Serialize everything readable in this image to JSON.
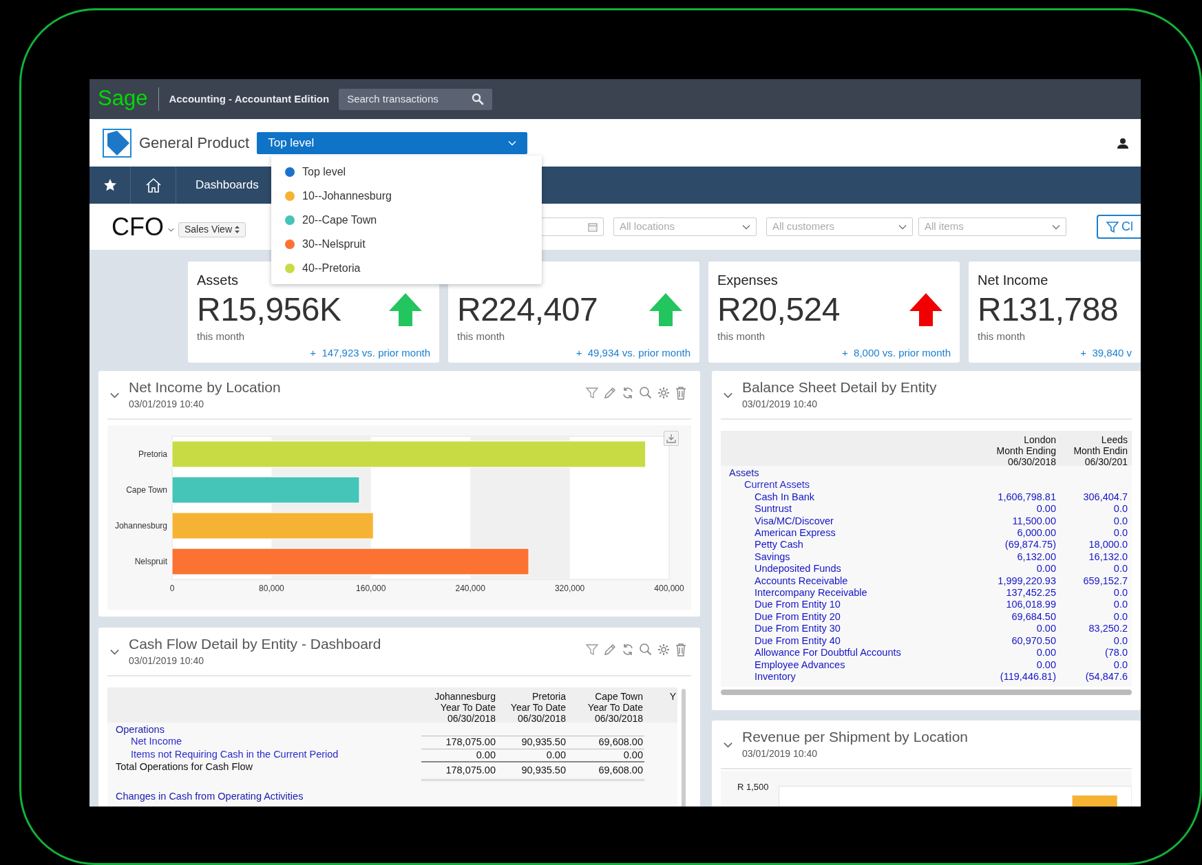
{
  "top_bar": {
    "brand": "Sage",
    "product": "Accounting - Accountant Edition",
    "search": {
      "placeholder": "Search transactions"
    }
  },
  "header": {
    "company": "General Product",
    "entity_select": {
      "value": "Top level",
      "expanded": true
    }
  },
  "entity_menu": [
    {
      "label": "Top level",
      "color": "#1a73c9"
    },
    {
      "label": "10--Johannesburg",
      "color": "#f6b333"
    },
    {
      "label": "20--Cape Town",
      "color": "#45c4b8"
    },
    {
      "label": "30--Nelspruit",
      "color": "#fb7232"
    },
    {
      "label": "40--Pretoria",
      "color": "#c8db45"
    }
  ],
  "nav": {
    "label": "Dashboards"
  },
  "toolbar": {
    "title": "CFO",
    "view_select": "Sales View",
    "filters": [
      {
        "placeholder": "All locations"
      },
      {
        "placeholder": "All customers"
      },
      {
        "placeholder": "All items"
      }
    ],
    "filter_button": "Cl"
  },
  "kpis": [
    {
      "title": "Assets",
      "value": "R15,956K",
      "period": "this month",
      "change": "+  147,923 vs. prior month",
      "color": "#22c55e"
    },
    {
      "value": "R224,407",
      "period": "this month",
      "change": "+  49,934 vs. prior month",
      "color": "#22c55e"
    },
    {
      "title": "Expenses",
      "value": "R20,524",
      "period": "this month",
      "change": "+  8,000 vs. prior month",
      "color": "#f00000"
    },
    {
      "title": "Net Income",
      "value": "R131,788",
      "period": "this month",
      "change": "+  39,840 v"
    }
  ],
  "left_panels": [
    {
      "kind": "bar_chart",
      "title": "Net Income by Location",
      "timestamp": "03/01/2019 10:40",
      "show_tools": true,
      "chart_data": {
        "type": "bar",
        "orientation": "horizontal",
        "categories": [
          "Pretoria",
          "Cape Town",
          "Johannesburg",
          "Nelspruit"
        ],
        "values": [
          381000,
          150700,
          161900,
          287000
        ],
        "colors": [
          "#c8db45",
          "#45c4b8",
          "#f6b333",
          "#fb7232"
        ],
        "xlim": [
          0,
          400000
        ],
        "xticks": [
          0,
          {
            "value": 80000,
            "label": "80,000"
          },
          {
            "value": 160000,
            "label": "160,000"
          },
          {
            "value": 240000,
            "label": "240,000"
          },
          {
            "value": 320000,
            "label": "320,000"
          },
          {
            "value": 400000,
            "label": "400,000"
          }
        ]
      }
    },
    {
      "kind": "table",
      "title": "Cash Flow Detail by Entity - Dashboard",
      "timestamp": "03/01/2019 10:40",
      "show_tools": true,
      "columns": [
        [
          "Johannesburg",
          "Year To Date",
          "06/30/2018"
        ],
        [
          "Pretoria",
          "Year To Date",
          "06/30/2018"
        ],
        [
          "Cape Town",
          "Year To Date",
          "06/30/2018"
        ],
        [
          "Y"
        ]
      ],
      "rows": [
        {
          "kind": "section",
          "label": "Operations",
          "values": []
        },
        {
          "kind": "item",
          "label": "Net Income",
          "values": [
            "178,075.00",
            "90,935.50",
            "69,608.00"
          ]
        },
        {
          "kind": "item",
          "label": "Items not Requiring Cash in the Current Period",
          "values": [
            "0.00",
            "0.00",
            "0.00"
          ]
        },
        {
          "kind": "total",
          "label": "Total Operations for Cash Flow",
          "values": [
            "178,075.00",
            "90,935.50",
            "69,608.00"
          ]
        },
        {
          "kind": "section",
          "label": "Changes in Cash from Operating Activities",
          "values": []
        }
      ]
    }
  ],
  "right_panels": [
    {
      "kind": "table",
      "title": "Balance Sheet Detail by Entity",
      "timestamp": "03/01/2019 10:40",
      "show_tools": false,
      "columns": [
        [
          "London",
          "Month Ending",
          "06/30/2018"
        ],
        [
          "Leeds",
          "Month Endin",
          "06/30/201"
        ]
      ],
      "rows": [
        {
          "kind": "section",
          "label": "Assets",
          "values": []
        },
        {
          "kind": "group",
          "label": "Current Assets",
          "values": []
        },
        {
          "kind": "account",
          "label": "Cash In Bank",
          "values": [
            "1,606,798.81",
            "306,404.7"
          ]
        },
        {
          "kind": "account",
          "label": "Suntrust",
          "values": [
            "0.00",
            "0.0"
          ]
        },
        {
          "kind": "account",
          "label": "Visa/MC/Discover",
          "values": [
            "11,500.00",
            "0.0"
          ]
        },
        {
          "kind": "account",
          "label": "American Express",
          "values": [
            "6,000.00",
            "0.0"
          ]
        },
        {
          "kind": "account",
          "label": "Petty Cash",
          "values": [
            "(69,874.75)",
            "18,000.0"
          ]
        },
        {
          "kind": "account",
          "label": "Savings",
          "values": [
            "6,132.00",
            "16,132.0"
          ]
        },
        {
          "kind": "account",
          "label": "Undeposited Funds",
          "values": [
            "0.00",
            "0.0"
          ]
        },
        {
          "kind": "account",
          "label": "Accounts Receivable",
          "values": [
            "1,999,220.93",
            "659,152.7"
          ]
        },
        {
          "kind": "account",
          "label": "Intercompany Receivable",
          "values": [
            "137,452.25",
            "0.0"
          ]
        },
        {
          "kind": "account",
          "label": "Due From Entity 10",
          "values": [
            "106,018.99",
            "0.0"
          ]
        },
        {
          "kind": "account",
          "label": "Due From Entity 20",
          "values": [
            "69,684.50",
            "0.0"
          ]
        },
        {
          "kind": "account",
          "label": "Due From Entity 30",
          "values": [
            "0.00",
            "83,250.2"
          ]
        },
        {
          "kind": "account",
          "label": "Due From Entity 40",
          "values": [
            "60,970.50",
            "0.0"
          ]
        },
        {
          "kind": "account",
          "label": "Allowance For Doubtful Accounts",
          "values": [
            "0.00",
            "(78.0"
          ]
        },
        {
          "kind": "account",
          "label": "Employee Advances",
          "values": [
            "0.00",
            "0.0"
          ]
        },
        {
          "kind": "account",
          "label": "Inventory",
          "values": [
            "(119,446.81)",
            "(54,847.6"
          ]
        }
      ]
    },
    {
      "kind": "revenue_chart",
      "title": "Revenue per Shipment by Location",
      "timestamp": "03/01/2019 10:40",
      "show_tools": false,
      "y_tick": "R 1,500"
    }
  ]
}
